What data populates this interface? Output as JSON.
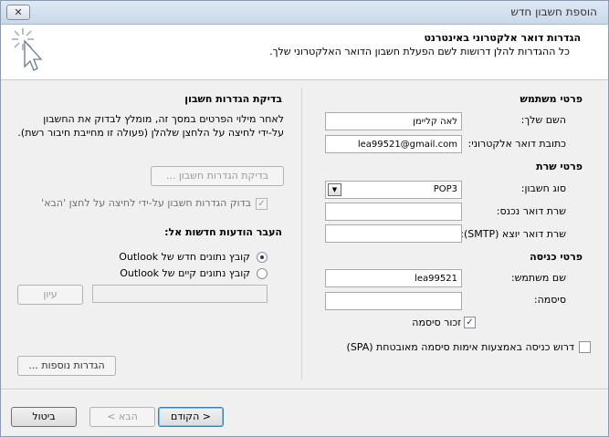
{
  "window": {
    "title": "הוספת חשבון חדש",
    "close_glyph": "✕"
  },
  "header": {
    "title": "הגדרות דואר אלקטרוני באינטרנט",
    "subtitle": "כל ההגדרות להלן דרושות לשם הפעלת חשבון הדואר האלקטרוני שלך."
  },
  "user_info": {
    "section": "פרטי משתמש",
    "name_label": "השם שלך:",
    "name_value": "לאה קליימן",
    "email_label": "כתובת דואר אלקטרוני:",
    "email_value": "lea99521@gmail.com"
  },
  "server_info": {
    "section": "פרטי שרת",
    "account_type_label": "סוג חשבון:",
    "account_type_value": "POP3",
    "incoming_label": "שרת דואר נכנס:",
    "incoming_value": "",
    "outgoing_label": "שרת דואר יוצא (SMTP):",
    "outgoing_value": ""
  },
  "logon_info": {
    "section": "פרטי כניסה",
    "username_label": "שם משתמש:",
    "username_value": "lea99521",
    "password_label": "סיסמה:",
    "password_value": "",
    "remember_label": "זכור סיסמה",
    "remember_checked": "✓",
    "spa_label": "דרוש כניסה באמצעות אימות סיסמה מאובטחת (SPA)"
  },
  "test": {
    "section": "בדיקת הגדרות חשבון",
    "description": "לאחר מילוי הפרטים במסך זה, מומלץ לבדוק את החשבון על-ידי לחיצה על הלחצן שלהלן (פעולה זו מחייבת חיבור רשת).",
    "test_button": "בדיקת הגדרות חשבון ...",
    "auto_test_label": "בדוק הגדרות חשבון על-ידי לחיצה על לחצן 'הבא'",
    "auto_test_checked": "✓"
  },
  "deliver": {
    "section": "העבר הודעות חדשות אל:",
    "option_new": "קובץ נתונים חדש של Outlook",
    "option_existing": "קובץ נתונים קיים של Outlook",
    "path_value": "",
    "browse_button": "עיון"
  },
  "more_settings_button": "הגדרות נוספות ...",
  "footer": {
    "back_button": "< הקודם",
    "next_button": "הבא >",
    "cancel_button": "ביטול"
  }
}
